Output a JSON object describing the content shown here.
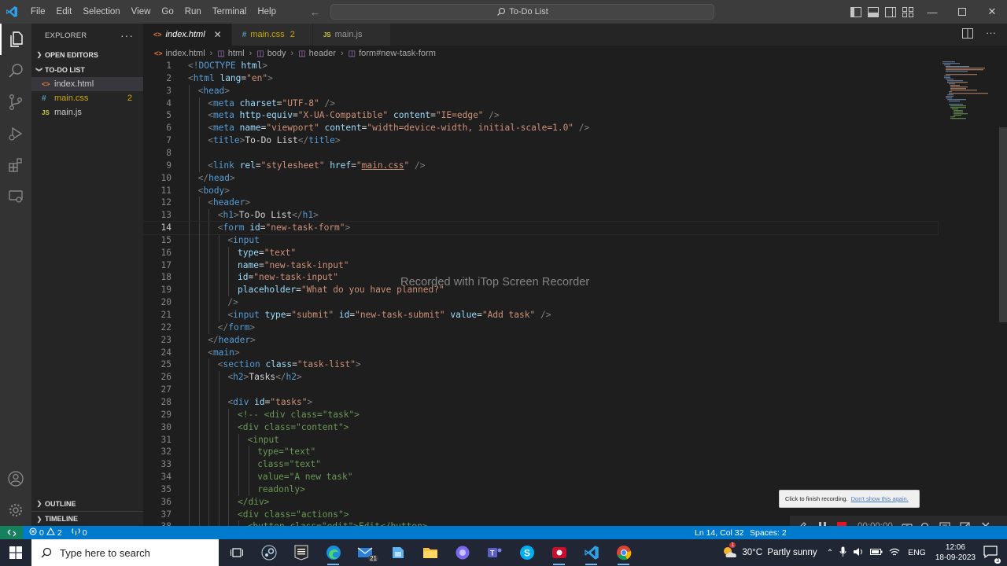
{
  "titlebar": {
    "menu": [
      "File",
      "Edit",
      "Selection",
      "View",
      "Go",
      "Run",
      "Terminal",
      "Help"
    ],
    "search_text": "To-Do List"
  },
  "sidebar": {
    "title": "EXPLORER",
    "open_editors": "OPEN EDITORS",
    "folder": "TO-DO LIST",
    "files": [
      {
        "name": "index.html",
        "icon": "<>",
        "color": "#e37933",
        "name_color": "#cccccc"
      },
      {
        "name": "main.css",
        "icon": "#",
        "color": "#519aba",
        "name_color": "#cca700",
        "badge": "2"
      },
      {
        "name": "main.js",
        "icon": "JS",
        "color": "#cbcb41",
        "name_color": "#cccccc"
      }
    ],
    "outline": "OUTLINE",
    "timeline": "TIMELINE"
  },
  "tabs": [
    {
      "label": "index.html",
      "icon": "<>",
      "icon_color": "#e37933",
      "active": true
    },
    {
      "label": "main.css",
      "icon": "#",
      "icon_color": "#519aba",
      "badge": "2"
    },
    {
      "label": "main.js",
      "icon": "JS",
      "icon_color": "#cbcb41"
    }
  ],
  "breadcrumb": [
    "index.html",
    "html",
    "body",
    "header",
    "form#new-task-form"
  ],
  "code": {
    "current_line": 14,
    "lines": [
      {
        "n": "1",
        "i": 0,
        "t": [
          [
            "br",
            "<!"
          ],
          [
            "tag",
            "DOCTYPE"
          ],
          [
            "txt",
            " "
          ],
          [
            "attr",
            "html"
          ],
          [
            "br",
            ">"
          ]
        ]
      },
      {
        "n": "2",
        "i": 0,
        "t": [
          [
            "br",
            "<"
          ],
          [
            "tag",
            "html"
          ],
          [
            "txt",
            " "
          ],
          [
            "attr",
            "lang"
          ],
          [
            "txt",
            "="
          ],
          [
            "str",
            "\"en\""
          ],
          [
            "br",
            ">"
          ]
        ]
      },
      {
        "n": "3",
        "i": 1,
        "t": [
          [
            "br",
            "<"
          ],
          [
            "tag",
            "head"
          ],
          [
            "br",
            ">"
          ]
        ]
      },
      {
        "n": "4",
        "i": 2,
        "t": [
          [
            "br",
            "<"
          ],
          [
            "tag",
            "meta"
          ],
          [
            "txt",
            " "
          ],
          [
            "attr",
            "charset"
          ],
          [
            "txt",
            "="
          ],
          [
            "str",
            "\"UTF-8\""
          ],
          [
            "txt",
            " "
          ],
          [
            "br",
            "/>"
          ]
        ]
      },
      {
        "n": "5",
        "i": 2,
        "t": [
          [
            "br",
            "<"
          ],
          [
            "tag",
            "meta"
          ],
          [
            "txt",
            " "
          ],
          [
            "attr",
            "http-equiv"
          ],
          [
            "txt",
            "="
          ],
          [
            "str",
            "\"X-UA-Compatible\""
          ],
          [
            "txt",
            " "
          ],
          [
            "attr",
            "content"
          ],
          [
            "txt",
            "="
          ],
          [
            "str",
            "\"IE=edge\""
          ],
          [
            "txt",
            " "
          ],
          [
            "br",
            "/>"
          ]
        ]
      },
      {
        "n": "6",
        "i": 2,
        "t": [
          [
            "br",
            "<"
          ],
          [
            "tag",
            "meta"
          ],
          [
            "txt",
            " "
          ],
          [
            "attr",
            "name"
          ],
          [
            "txt",
            "="
          ],
          [
            "str",
            "\"viewport\""
          ],
          [
            "txt",
            " "
          ],
          [
            "attr",
            "content"
          ],
          [
            "txt",
            "="
          ],
          [
            "str",
            "\"width=device-width, initial-scale=1.0\""
          ],
          [
            "txt",
            " "
          ],
          [
            "br",
            "/>"
          ]
        ]
      },
      {
        "n": "7",
        "i": 2,
        "t": [
          [
            "br",
            "<"
          ],
          [
            "tag",
            "title"
          ],
          [
            "br",
            ">"
          ],
          [
            "txt",
            "To-Do List"
          ],
          [
            "br",
            "</"
          ],
          [
            "tag",
            "title"
          ],
          [
            "br",
            ">"
          ]
        ]
      },
      {
        "n": "8",
        "i": 2,
        "t": []
      },
      {
        "n": "9",
        "i": 2,
        "t": [
          [
            "br",
            "<"
          ],
          [
            "tag",
            "link"
          ],
          [
            "txt",
            " "
          ],
          [
            "attr",
            "rel"
          ],
          [
            "txt",
            "="
          ],
          [
            "str",
            "\"stylesheet\""
          ],
          [
            "txt",
            " "
          ],
          [
            "attr",
            "href"
          ],
          [
            "txt",
            "="
          ],
          [
            "str",
            "\""
          ],
          [
            "und",
            "main.css"
          ],
          [
            "str",
            "\""
          ],
          [
            "txt",
            " "
          ],
          [
            "br",
            "/>"
          ]
        ]
      },
      {
        "n": "10",
        "i": 1,
        "t": [
          [
            "br",
            "</"
          ],
          [
            "tag",
            "head"
          ],
          [
            "br",
            ">"
          ]
        ]
      },
      {
        "n": "11",
        "i": 1,
        "t": [
          [
            "br",
            "<"
          ],
          [
            "tag",
            "body"
          ],
          [
            "br",
            ">"
          ]
        ]
      },
      {
        "n": "12",
        "i": 2,
        "t": [
          [
            "br",
            "<"
          ],
          [
            "tag",
            "header"
          ],
          [
            "br",
            ">"
          ]
        ]
      },
      {
        "n": "13",
        "i": 3,
        "t": [
          [
            "br",
            "<"
          ],
          [
            "tag",
            "h1"
          ],
          [
            "br",
            ">"
          ],
          [
            "txt",
            "To-Do List"
          ],
          [
            "br",
            "</"
          ],
          [
            "tag",
            "h1"
          ],
          [
            "br",
            ">"
          ]
        ]
      },
      {
        "n": "14",
        "i": 3,
        "t": [
          [
            "br",
            "<"
          ],
          [
            "tag",
            "form"
          ],
          [
            "txt",
            " "
          ],
          [
            "attr",
            "id"
          ],
          [
            "txt",
            "="
          ],
          [
            "str",
            "\"new-task-form\""
          ],
          [
            "br",
            ">"
          ]
        ]
      },
      {
        "n": "15",
        "i": 4,
        "t": [
          [
            "br",
            "<"
          ],
          [
            "tag",
            "input"
          ]
        ]
      },
      {
        "n": "16",
        "i": 5,
        "t": [
          [
            "attr",
            "type"
          ],
          [
            "txt",
            "="
          ],
          [
            "str",
            "\"text\""
          ]
        ]
      },
      {
        "n": "17",
        "i": 5,
        "t": [
          [
            "attr",
            "name"
          ],
          [
            "txt",
            "="
          ],
          [
            "str",
            "\"new-task-input\""
          ]
        ]
      },
      {
        "n": "18",
        "i": 5,
        "t": [
          [
            "attr",
            "id"
          ],
          [
            "txt",
            "="
          ],
          [
            "str",
            "\"new-task-input\""
          ]
        ]
      },
      {
        "n": "19",
        "i": 5,
        "t": [
          [
            "attr",
            "placeholder"
          ],
          [
            "txt",
            "="
          ],
          [
            "str",
            "\"What do you have planned?\""
          ]
        ]
      },
      {
        "n": "20",
        "i": 4,
        "t": [
          [
            "br",
            "/>"
          ]
        ]
      },
      {
        "n": "21",
        "i": 4,
        "t": [
          [
            "br",
            "<"
          ],
          [
            "tag",
            "input"
          ],
          [
            "txt",
            " "
          ],
          [
            "attr",
            "type"
          ],
          [
            "txt",
            "="
          ],
          [
            "str",
            "\"submit\""
          ],
          [
            "txt",
            " "
          ],
          [
            "attr",
            "id"
          ],
          [
            "txt",
            "="
          ],
          [
            "str",
            "\"new-task-submit\""
          ],
          [
            "txt",
            " "
          ],
          [
            "attr",
            "value"
          ],
          [
            "txt",
            "="
          ],
          [
            "str",
            "\"Add task\""
          ],
          [
            "txt",
            " "
          ],
          [
            "br",
            "/>"
          ]
        ]
      },
      {
        "n": "22",
        "i": 3,
        "t": [
          [
            "br",
            "</"
          ],
          [
            "tag",
            "form"
          ],
          [
            "br",
            ">"
          ]
        ]
      },
      {
        "n": "23",
        "i": 2,
        "t": [
          [
            "br",
            "</"
          ],
          [
            "tag",
            "header"
          ],
          [
            "br",
            ">"
          ]
        ]
      },
      {
        "n": "24",
        "i": 2,
        "t": [
          [
            "br",
            "<"
          ],
          [
            "tag",
            "main"
          ],
          [
            "br",
            ">"
          ]
        ]
      },
      {
        "n": "25",
        "i": 3,
        "t": [
          [
            "br",
            "<"
          ],
          [
            "tag",
            "section"
          ],
          [
            "txt",
            " "
          ],
          [
            "attr",
            "class"
          ],
          [
            "txt",
            "="
          ],
          [
            "str",
            "\"task-list\""
          ],
          [
            "br",
            ">"
          ]
        ]
      },
      {
        "n": "26",
        "i": 4,
        "t": [
          [
            "br",
            "<"
          ],
          [
            "tag",
            "h2"
          ],
          [
            "br",
            ">"
          ],
          [
            "txt",
            "Tasks"
          ],
          [
            "br",
            "</"
          ],
          [
            "tag",
            "h2"
          ],
          [
            "br",
            ">"
          ]
        ]
      },
      {
        "n": "27",
        "i": 4,
        "t": []
      },
      {
        "n": "28",
        "i": 4,
        "t": [
          [
            "br",
            "<"
          ],
          [
            "tag",
            "div"
          ],
          [
            "txt",
            " "
          ],
          [
            "attr",
            "id"
          ],
          [
            "txt",
            "="
          ],
          [
            "str",
            "\"tasks\""
          ],
          [
            "br",
            ">"
          ]
        ]
      },
      {
        "n": "29",
        "i": 5,
        "t": [
          [
            "com",
            "<!-- <div class=\"task\">"
          ]
        ]
      },
      {
        "n": "30",
        "i": 5,
        "t": [
          [
            "com",
            "<div class=\"content\">"
          ]
        ]
      },
      {
        "n": "31",
        "i": 6,
        "t": [
          [
            "com",
            "<input"
          ]
        ]
      },
      {
        "n": "32",
        "i": 7,
        "t": [
          [
            "com",
            "type=\"text\""
          ]
        ]
      },
      {
        "n": "33",
        "i": 7,
        "t": [
          [
            "com",
            "class=\"text\""
          ]
        ]
      },
      {
        "n": "34",
        "i": 7,
        "t": [
          [
            "com",
            "value=\"A new task\""
          ]
        ]
      },
      {
        "n": "35",
        "i": 7,
        "t": [
          [
            "com",
            "readonly>"
          ]
        ]
      },
      {
        "n": "36",
        "i": 5,
        "t": [
          [
            "com",
            "</div>"
          ]
        ]
      },
      {
        "n": "37",
        "i": 5,
        "t": [
          [
            "com",
            "<div class=\"actions\">"
          ]
        ]
      },
      {
        "n": "38",
        "i": 6,
        "t": [
          [
            "com",
            "<button class=\"edit\">Edit</button>"
          ]
        ]
      }
    ]
  },
  "watermark": "Recorded with iTop Screen Recorder",
  "recorder": {
    "tooltip_text": "Click to finish recording.",
    "tooltip_link": "Don't show this again.",
    "time": "00:00:00"
  },
  "statusbar": {
    "errors": "0",
    "warnings": "2",
    "ports": "0",
    "position": "Ln 14, Col 32",
    "spaces": "Spaces: 2"
  },
  "taskbar": {
    "search_placeholder": "Type here to search",
    "mail_badge": "21",
    "weather": "30°C  Partly sunny",
    "weather_badge": "1",
    "lang": "ENG",
    "time": "12:06",
    "date": "18-09-2023",
    "notif_count": "3"
  },
  "colors": {
    "accent": "#007acc",
    "remote": "#16825d",
    "warning": "#cca700",
    "record": "#e81123"
  }
}
